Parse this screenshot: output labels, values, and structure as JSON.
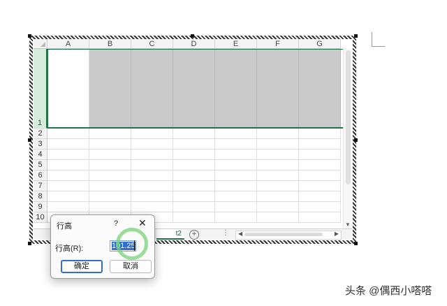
{
  "sheet": {
    "columns": [
      "A",
      "B",
      "C",
      "D",
      "E",
      "F",
      "G"
    ],
    "rows": [
      "1",
      "2",
      "3",
      "4",
      "5",
      "6",
      "7",
      "8",
      "9",
      "10"
    ],
    "sheet_tab": "t2",
    "add_sheet_label": "+",
    "more": "⋮"
  },
  "dialog": {
    "title": "行高",
    "help": "?",
    "close": "✕",
    "field_label": "行高(R):",
    "field_value": "101.25",
    "ok_label": "确定",
    "cancel_label": "取消"
  },
  "watermark": "头条 @偶西小嗒嗒",
  "colors": {
    "selection": "#217346",
    "gray_fill": "#c9c9c9",
    "highlight_ring": "#7ad27a"
  }
}
